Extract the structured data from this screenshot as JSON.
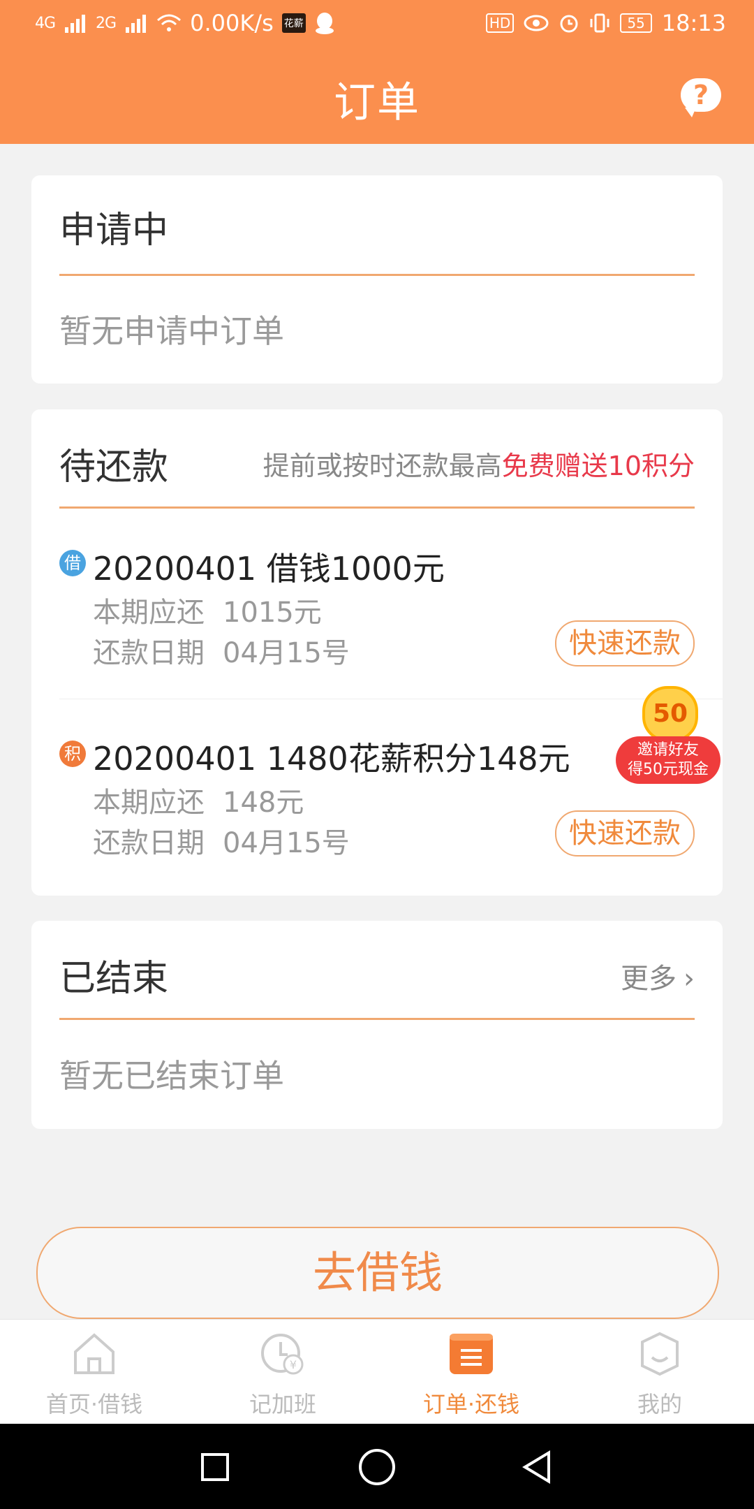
{
  "status_bar": {
    "net_left": "4G",
    "net_right": "2G",
    "speed": "0.00K/s",
    "app_badge": "花薪",
    "hd": "HD",
    "battery": "55",
    "time": "18:13"
  },
  "header": {
    "title": "订单",
    "help": "?"
  },
  "applying": {
    "title": "申请中",
    "empty": "暂无申请中订单"
  },
  "pending": {
    "title": "待还款",
    "hint_prefix": "提前或按时还款最高",
    "hint_highlight": "免费赠送10积分",
    "orders": [
      {
        "badge": "借",
        "title": "20200401  借钱1000元",
        "due_label": "本期应还",
        "due_value": "1015元",
        "date_label": "还款日期",
        "date_value": "04月15号",
        "button": "快速还款"
      },
      {
        "badge": "积",
        "title": "20200401  1480花薪积分148元",
        "due_label": "本期应还",
        "due_value": "148元",
        "date_label": "还款日期",
        "date_value": "04月15号",
        "button": "快速还款"
      }
    ]
  },
  "finished": {
    "title": "已结束",
    "more": "更多",
    "empty": "暂无已结束订单"
  },
  "promo": {
    "amount": "50",
    "line1": "邀请好友",
    "line2": "得50元现金"
  },
  "borrow_button": "去借钱",
  "tabs": [
    {
      "label": "首页·借钱",
      "icon": "home-icon"
    },
    {
      "label": "记加班",
      "icon": "clock-yen-icon"
    },
    {
      "label": "订单·还钱",
      "icon": "order-list-icon"
    },
    {
      "label": "我的",
      "icon": "profile-face-icon"
    }
  ],
  "colors": {
    "accent": "#fb8f4e",
    "highlight_red": "#e8394a",
    "badge_blue": "#4aa3e0",
    "badge_orange": "#f07a3a"
  }
}
